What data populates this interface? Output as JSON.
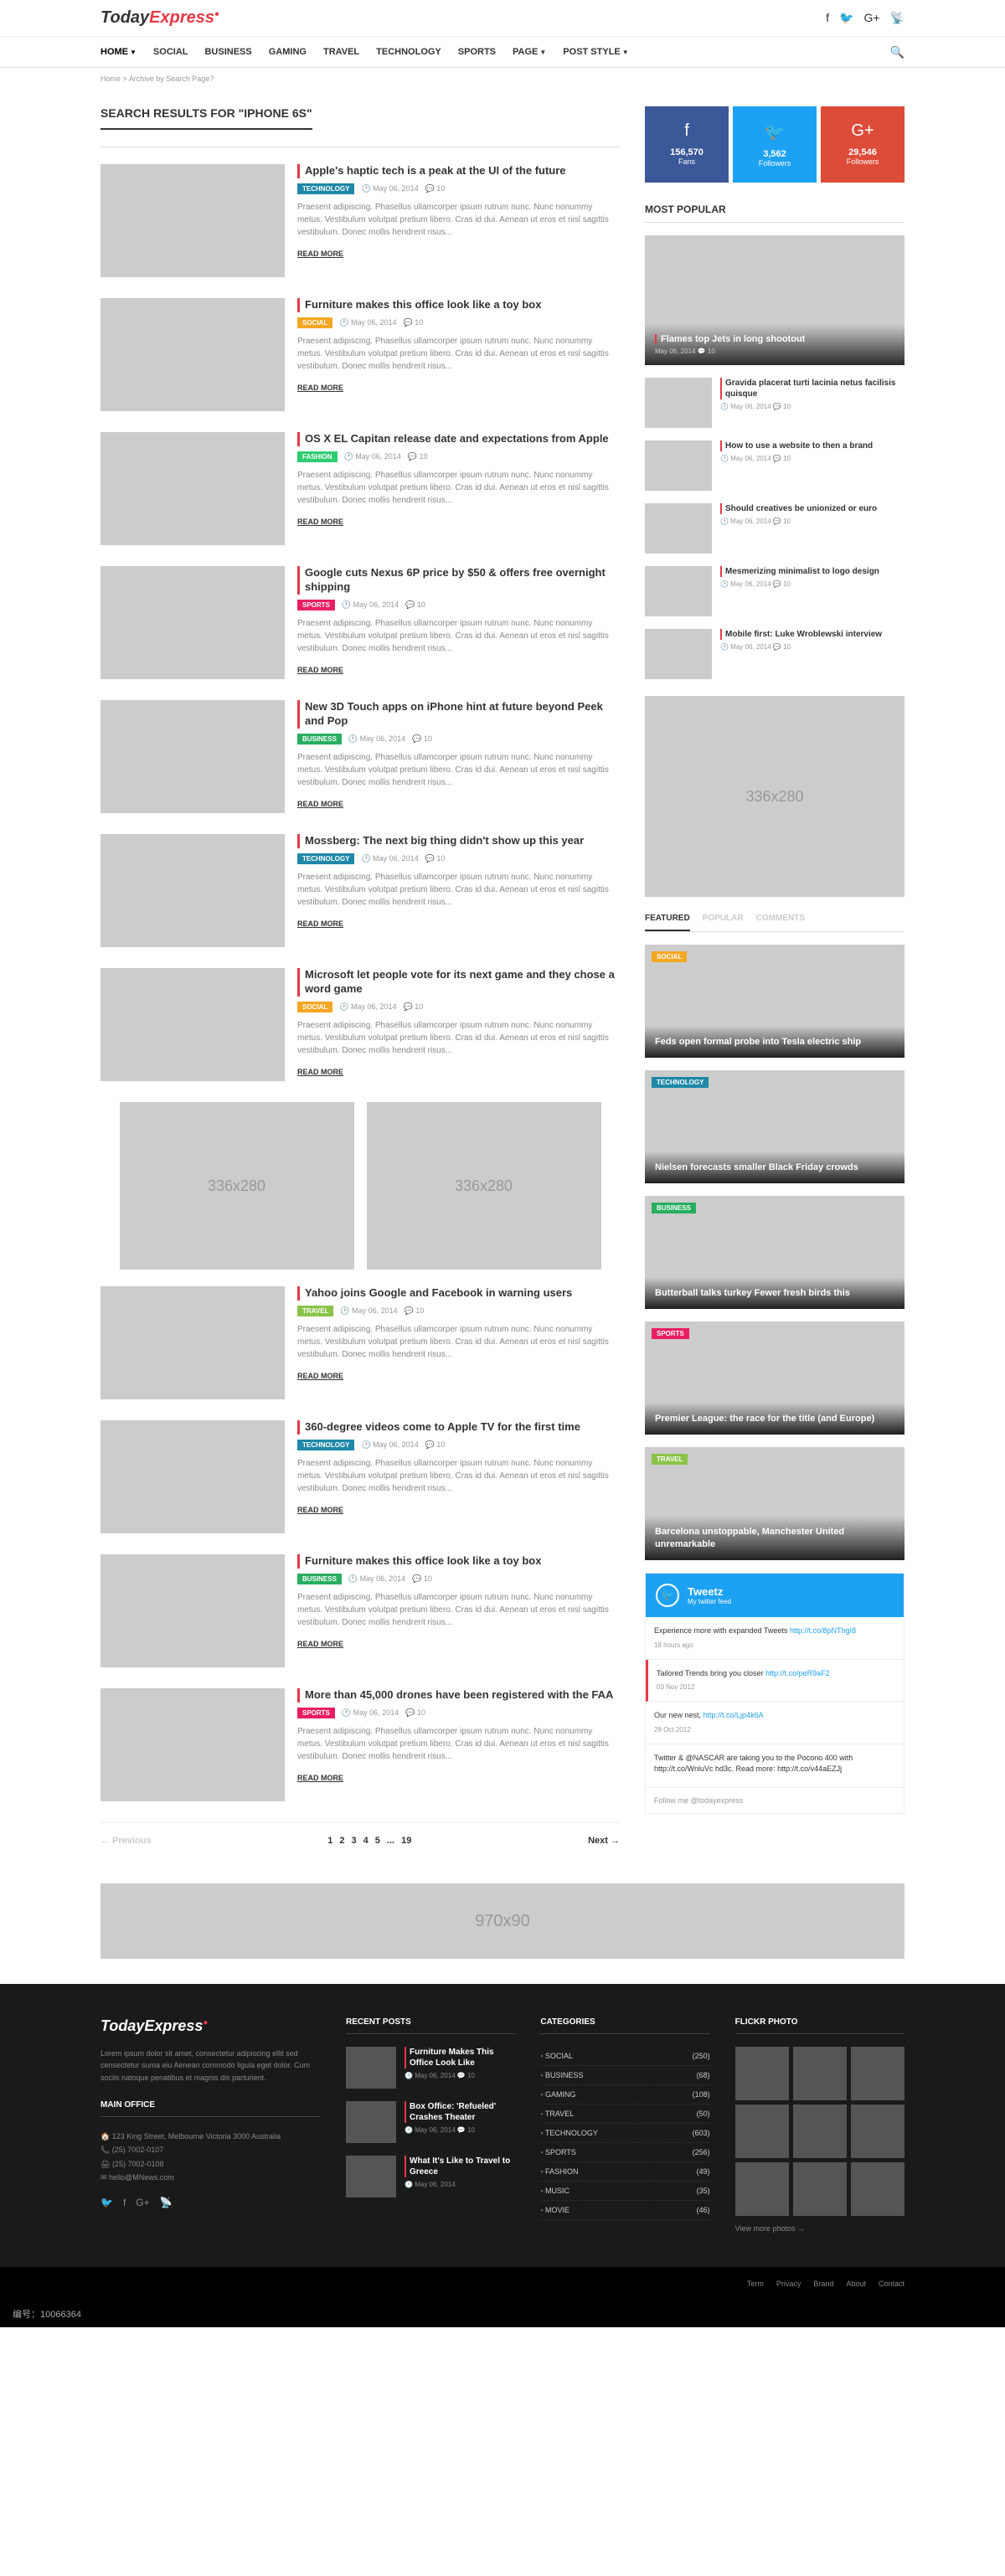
{
  "logo": {
    "today": "Today",
    "express": "Express"
  },
  "topSocial": [
    "f",
    "🐦",
    "G+",
    "📡"
  ],
  "nav": [
    {
      "label": "HOME",
      "caret": true,
      "active": true
    },
    {
      "label": "SOCIAL"
    },
    {
      "label": "BUSINESS"
    },
    {
      "label": "GAMING"
    },
    {
      "label": "TRAVEL"
    },
    {
      "label": "TECHNOLOGY"
    },
    {
      "label": "SPORTS"
    },
    {
      "label": "PAGE",
      "caret": true
    },
    {
      "label": "POST STYLE",
      "caret": true
    }
  ],
  "breadcrumb": "Home > Archive by Search Page?",
  "pageTitle": "SEARCH RESULTS FOR \"IPHONE 6S\"",
  "articles": [
    {
      "title": "Apple's haptic tech is a peak at the UI of the future",
      "cat": "TECHNOLOGY",
      "catClass": "cat-technology",
      "date": "May 06, 2014",
      "comments": "10"
    },
    {
      "title": "Furniture makes this office look like a toy box",
      "cat": "SOCIAL",
      "catClass": "cat-social",
      "date": "May 06, 2014",
      "comments": "10"
    },
    {
      "title": "OS X EL Capitan release date and expectations from Apple",
      "cat": "FASHION",
      "catClass": "cat-fashion",
      "date": "May 06, 2014",
      "comments": "10"
    },
    {
      "title": "Google cuts Nexus 6P price by $50 & offers free overnight shipping",
      "cat": "SPORTS",
      "catClass": "cat-sports",
      "date": "May 06, 2014",
      "comments": "10"
    },
    {
      "title": "New 3D Touch apps on iPhone hint at future beyond Peek and Pop",
      "cat": "BUSINESS",
      "catClass": "cat-business",
      "date": "May 06, 2014",
      "comments": "10"
    },
    {
      "title": "Mossberg: The next big thing didn't show up this year",
      "cat": "TECHNOLOGY",
      "catClass": "cat-technology",
      "date": "May 06, 2014",
      "comments": "10"
    },
    {
      "title": "Microsoft let people vote for its next game and they chose a word game",
      "cat": "SOCIAL",
      "catClass": "cat-social",
      "date": "May 06, 2014",
      "comments": "10"
    }
  ],
  "articles2": [
    {
      "title": "Yahoo joins Google and Facebook in warning users",
      "cat": "TRAVEL",
      "catClass": "cat-travel",
      "date": "May 06, 2014",
      "comments": "10"
    },
    {
      "title": "360-degree videos come to Apple TV for the first time",
      "cat": "TECHNOLOGY",
      "catClass": "cat-technology",
      "date": "May 06, 2014",
      "comments": "10"
    },
    {
      "title": "Furniture makes this office look like a toy box",
      "cat": "BUSINESS",
      "catClass": "cat-business",
      "date": "May 06, 2014",
      "comments": "10"
    },
    {
      "title": "More than 45,000 drones have been registered with the FAA",
      "cat": "SPORTS",
      "catClass": "cat-sports",
      "date": "May 06, 2014",
      "comments": "10"
    }
  ],
  "excerpt": "Praesent adipiscing. Phasellus ullamcorper ipsum rutrum nunc. Nunc nonummy metus. Vestibulum volutpat pretium libero. Cras id dui. Aenean ut eros et nisl sagittis vestibulum. Donec mollis hendrerit risus...",
  "readMore": "READ MORE",
  "adLabel": "336x280",
  "bannerLabel": "970x90",
  "pagination": {
    "prev": "← Previous",
    "nums": [
      "1",
      "2",
      "3",
      "4",
      "5",
      "...",
      "19"
    ],
    "next": "Next →"
  },
  "socialBoxes": [
    {
      "icon": "f",
      "count": "156,570",
      "label": "Fans",
      "cls": "sb-fb"
    },
    {
      "icon": "🐦",
      "count": "3,562",
      "label": "Followers",
      "cls": "sb-tw"
    },
    {
      "icon": "G+",
      "count": "29,546",
      "label": "Followers",
      "cls": "sb-gp"
    }
  ],
  "mostPopularTitle": "MOST POPULAR",
  "popHero": {
    "title": "Flames top Jets in long shootout",
    "date": "May 06, 2014",
    "comments": "10"
  },
  "popItems": [
    {
      "title": "Gravida placerat turti lacinia netus facilisis quisque",
      "date": "May 06, 2014",
      "comments": "10"
    },
    {
      "title": "How to use a website to then a brand",
      "date": "May 06, 2014",
      "comments": "10"
    },
    {
      "title": "Should creatives be unionized or euro",
      "date": "May 06, 2014",
      "comments": "10"
    },
    {
      "title": "Mesmerizing minimalist to logo design",
      "date": "May 06, 2014",
      "comments": "10"
    },
    {
      "title": "Mobile first: Luke Wroblewski interview",
      "date": "May 06, 2014",
      "comments": "10"
    }
  ],
  "tabs": [
    "FEATURED",
    "POPULAR",
    "COMMENTS"
  ],
  "featured": [
    {
      "title": "Feds open formal probe into Tesla electric ship",
      "cat": "SOCIAL",
      "catClass": "cat-social"
    },
    {
      "title": "Nielsen forecasts smaller Black Friday crowds",
      "cat": "TECHNOLOGY",
      "catClass": "cat-technology"
    },
    {
      "title": "Butterball talks turkey Fewer fresh birds this",
      "cat": "BUSINESS",
      "catClass": "cat-business"
    },
    {
      "title": "Premier League: the race for the title (and Europe)",
      "cat": "SPORTS",
      "catClass": "cat-sports"
    },
    {
      "title": "Barcelona unstoppable, Manchester United unremarkable",
      "cat": "TRAVEL",
      "catClass": "cat-travel"
    }
  ],
  "tweetz": {
    "title": "Tweetz",
    "sub": "My twitter feed",
    "tweets": [
      {
        "text": "Experience more with expanded Tweets ",
        "link": "http://t.co/8pNThgI8",
        "time": "18 hours ago"
      },
      {
        "text": "Tailored Trends bring you closer ",
        "link": "http://t.co/peR9aF2",
        "time": "03 Nov 2012",
        "highlight": true
      },
      {
        "text": "Our new nest, ",
        "link": "http://t.co/Ljp4k6A",
        "time": "28 Oct 2012"
      },
      {
        "text": "Twitter & @NASCAR are taking you to the Pocono 400 with http://t.co/WnluVc hd3c. Read more: http://t.co/v44aEZJj",
        "time": ""
      }
    ],
    "footer": "Follow me @todayexpress"
  },
  "footer": {
    "desc": "Lorem ipsum dolor sit amet, consectetur adipiscing ellit sed censectetur suma eiu Aenean commodo ligula eget dolor. Cum sociis natoque penatibus et magnis dis parturient.",
    "officeTitle": "MAIN OFFICE",
    "address": "123 King Street, Melbourne Victoria 3000 Australia",
    "phone": "(25) 7002-0107",
    "fax": "(25) 7002-0108",
    "email": "hello@MNews.com",
    "recentTitle": "RECENT POSTS",
    "recent": [
      {
        "title": "Furniture Makes This Office Look Like",
        "date": "May 06, 2014",
        "comments": "10"
      },
      {
        "title": "Box Office: 'Refueled' Crashes Theater",
        "date": "May 06, 2014",
        "comments": "10"
      },
      {
        "title": "What It's Like to Travel to Greece",
        "date": "May 06, 2014"
      }
    ],
    "catTitle": "CATEGORIES",
    "categories": [
      {
        "name": "SOCIAL",
        "count": "(250)"
      },
      {
        "name": "BUSINESS",
        "count": "(68)"
      },
      {
        "name": "GAMING",
        "count": "(108)"
      },
      {
        "name": "TRAVEL",
        "count": "(50)"
      },
      {
        "name": "TECHNOLOGY",
        "count": "(603)"
      },
      {
        "name": "SPORTS",
        "count": "(256)"
      },
      {
        "name": "FASHION",
        "count": "(49)"
      },
      {
        "name": "MUSIC",
        "count": "(35)"
      },
      {
        "name": "MOVIE",
        "count": "(46)"
      }
    ],
    "flickrTitle": "FLICKR PHOTO",
    "flickrMore": "View more photos →",
    "bottomLinks": [
      "Term",
      "Privacy",
      "Brand",
      "About",
      "Contact"
    ]
  },
  "imgMeta": {
    "id": "编号：10066364",
    "site": ""
  }
}
